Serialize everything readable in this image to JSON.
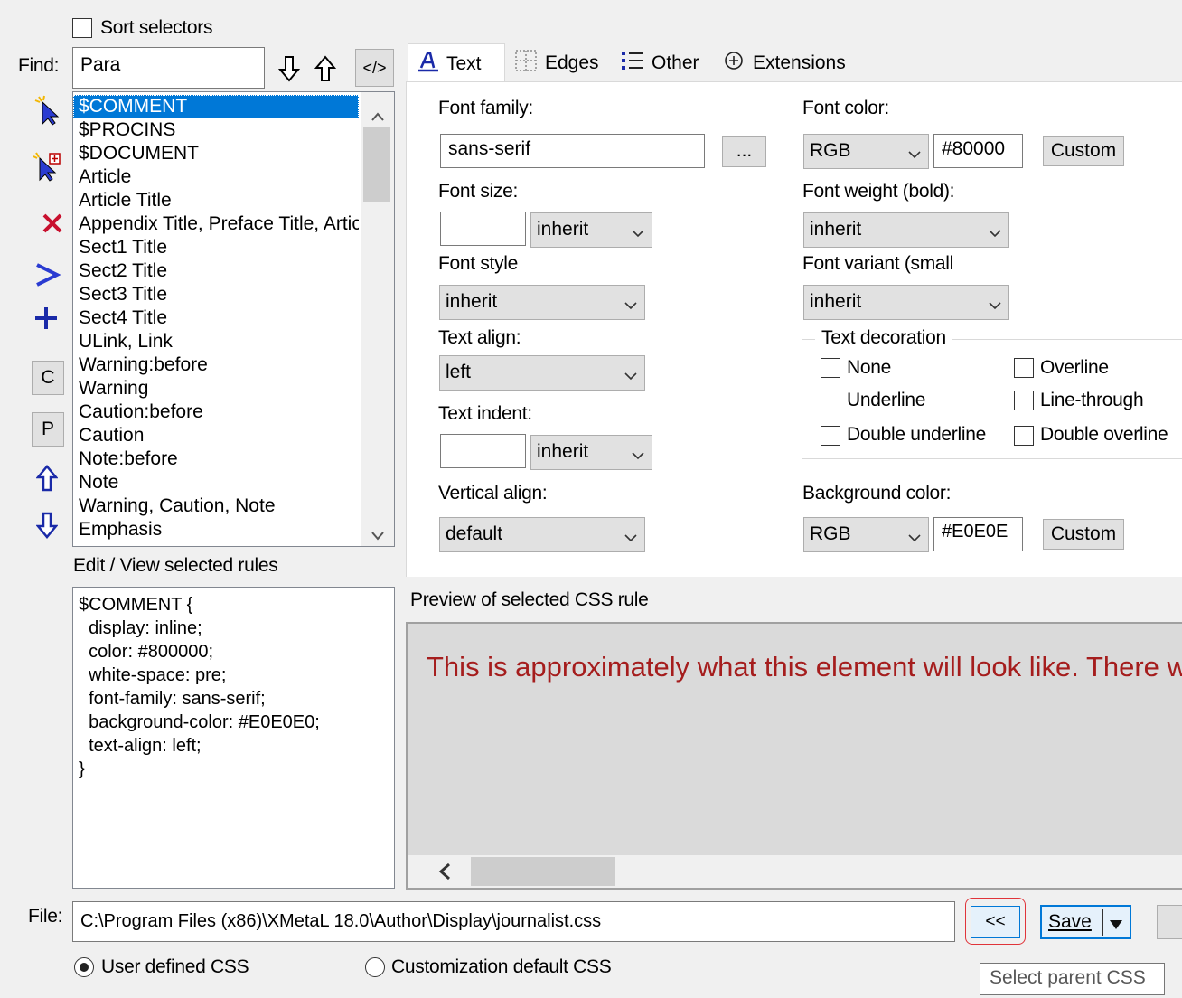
{
  "top": {
    "sort_label": "Sort selectors"
  },
  "find": {
    "label": "Find:",
    "value": "Para",
    "xml_toggle": "</>"
  },
  "selectors": [
    "$COMMENT",
    "$PROCINS",
    "$DOCUMENT",
    "Article",
    "Article Title",
    "Appendix Title, Preface Title, Artic",
    "Sect1 Title",
    "Sect2 Title",
    "Sect3 Title",
    "Sect4 Title",
    "ULink, Link",
    "Warning:before",
    "Warning",
    "Caution:before",
    "Caution",
    "Note:before",
    "Note",
    "Warning, Caution, Note",
    "Emphasis"
  ],
  "side_buttons": {
    "c_label": "C",
    "p_label": "P"
  },
  "rules": {
    "label": "Edit / View selected rules",
    "text": "$COMMENT {\n  display: inline;\n  color: #800000;\n  white-space: pre;\n  font-family: sans-serif;\n  background-color: #E0E0E0;\n  text-align: left;\n}"
  },
  "tabs": [
    "Text",
    "Edges",
    "Other",
    "Extensions"
  ],
  "text_tab": {
    "font_family_label": "Font family:",
    "font_family_value": "sans-serif",
    "browse_label": "...",
    "font_size_label": "Font size:",
    "font_size_value": "",
    "font_size_unit": "inherit",
    "font_style_label": "Font style",
    "font_style_value": "inherit",
    "text_align_label": "Text align:",
    "text_align_value": "left",
    "text_indent_label": "Text indent:",
    "text_indent_value": "",
    "text_indent_unit": "inherit",
    "vertical_align_label": "Vertical align:",
    "vertical_align_value": "default",
    "font_color_label": "Font color:",
    "font_color_mode": "RGB",
    "font_color_value": "#80000",
    "custom_label": "Custom",
    "font_weight_label": "Font weight (bold):",
    "font_weight_value": "inherit",
    "font_variant_label": "Font variant (small",
    "font_variant_value": "inherit",
    "text_decoration_label": "Text decoration",
    "decorations": {
      "none": "None",
      "overline": "Overline",
      "underline": "Underline",
      "line_through": "Line-through",
      "double_underline": "Double underline",
      "double_overline": "Double overline"
    },
    "background_color_label": "Background color:",
    "background_color_mode": "RGB",
    "background_color_value": "#E0E0E"
  },
  "preview": {
    "label": "Preview of selected CSS rule",
    "text": "This is approximately what this element will look like. There w",
    "text_color": "#a51d1d",
    "bg_color": "#dadada"
  },
  "file": {
    "label": "File:",
    "path": "C:\\Program Files (x86)\\XMetaL 18.0\\Author\\Display\\journalist.css",
    "parent_button": "<<",
    "save_label": "Save",
    "user_css_label": "User defined CSS",
    "default_css_label": "Customization default CSS",
    "tooltip": "Select parent CSS"
  }
}
